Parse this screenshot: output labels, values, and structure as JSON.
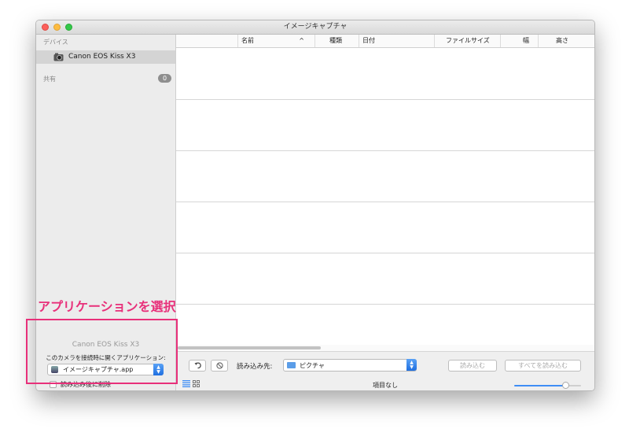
{
  "window": {
    "title": "イメージキャプチャ"
  },
  "sidebar": {
    "devices_header": "デバイス",
    "device_name": "Canon EOS Kiss X3",
    "shared_header": "共有",
    "shared_count": "0"
  },
  "device_pane": {
    "title": "Canon EOS Kiss X3",
    "open_with_label": "このカメラを接続時に開くアプリケーション:",
    "app_selected": "イメージキャプチャ.app",
    "delete_after_import_label": "読み込み後に削除",
    "delete_after_import_checked": false
  },
  "table": {
    "columns": [
      "名前",
      "^",
      "種類",
      "日付",
      "ファイルサイズ",
      "幅",
      "高さ"
    ]
  },
  "toolbar": {
    "rotate_icon": "rotate-left-icon",
    "delete_icon": "no-entry-icon",
    "import_to_label": "読み込み先:",
    "destination": "ピクチャ",
    "import_button": "読み込む",
    "import_all_button": "すべてを読み込む",
    "status": "項目なし",
    "thumbnail_size": 0.77
  },
  "annotation": {
    "text": "アプリケーションを選択",
    "color": "#e8307a"
  },
  "colors": {
    "accent": "#3f8ef6",
    "sidebar_selection": "#d4d4d4"
  }
}
